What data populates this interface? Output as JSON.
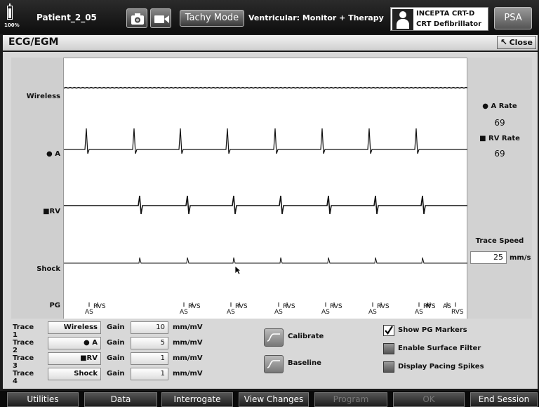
{
  "header": {
    "battery_percent": "100%",
    "patient": "Patient_2_05",
    "tachy_mode_label": "Tachy Mode",
    "ventricular_mode": "Ventricular: Monitor + Therapy",
    "device_name": "INCEPTA CRT-D",
    "device_type": "CRT Defibrillator",
    "psa_label": "PSA"
  },
  "title_bar": {
    "title": "ECG/EGM",
    "close_label": "Close"
  },
  "traces": {
    "labels": [
      "Wireless",
      "A",
      "RV",
      "Shock",
      "PG"
    ]
  },
  "markers": [
    "AS",
    "RVS",
    "AS",
    "RVS",
    "AS",
    "RVS",
    "AS",
    "RVS",
    "AS",
    "RVS",
    "AS",
    "RVS",
    "AS",
    "RVS",
    "R",
    "AS",
    "RVS"
  ],
  "rates": {
    "a_label": "A Rate",
    "a_value": "69",
    "rv_label": "RV Rate",
    "rv_value": "69"
  },
  "trace_speed": {
    "label": "Trace Speed",
    "value": "25",
    "unit": "mm/s"
  },
  "controls": {
    "rows": [
      {
        "name": "Trace 1",
        "source": "Wireless",
        "gain_label": "Gain",
        "gain": "10",
        "unit": "mm/mV"
      },
      {
        "name": "Trace 2",
        "source": "A",
        "gain_label": "Gain",
        "gain": "5",
        "unit": "mm/mV"
      },
      {
        "name": "Trace 3",
        "source": "RV",
        "gain_label": "Gain",
        "gain": "1",
        "unit": "mm/mV"
      },
      {
        "name": "Trace 4",
        "source": "Shock",
        "gain_label": "Gain",
        "gain": "1",
        "unit": "mm/mV"
      }
    ],
    "calibrate_label": "Calibrate",
    "baseline_label": "Baseline",
    "checkboxes": [
      {
        "label": "Show PG Markers",
        "checked": true
      },
      {
        "label": "Enable Surface Filter",
        "checked": false
      },
      {
        "label": "Display Pacing Spikes",
        "checked": false
      }
    ]
  },
  "nav": [
    "Utilities",
    "Data",
    "Interrogate",
    "View Changes",
    "Program",
    "OK",
    "End Session"
  ],
  "icons": [
    "battery-icon",
    "camera-icon",
    "video-icon",
    "patient-icon",
    "close-arrow-icon",
    "calibrate-icon",
    "baseline-icon",
    "cursor-icon"
  ]
}
